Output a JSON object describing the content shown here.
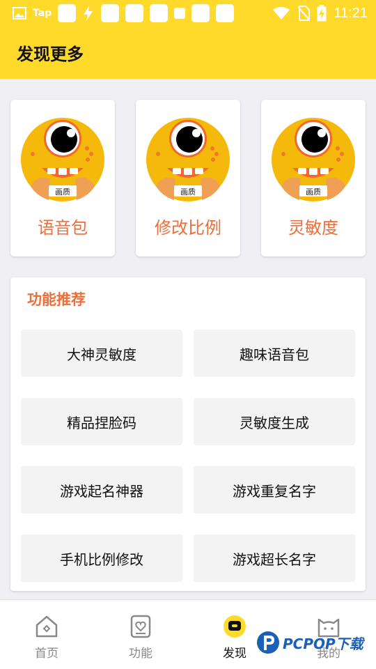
{
  "status_bar": {
    "app_label": "Tap",
    "time": "11:21"
  },
  "header": {
    "title": "发现更多"
  },
  "top_cards": [
    {
      "label": "语音包",
      "icon": "mascot-avatar"
    },
    {
      "label": "修改比例",
      "icon": "mascot-avatar"
    },
    {
      "label": "灵敏度",
      "icon": "mascot-avatar"
    }
  ],
  "mascot_badge_text": "画质",
  "features": {
    "title": "功能推荐",
    "buttons": [
      "大神灵敏度",
      "趣味语音包",
      "精品捏脸码",
      "灵敏度生成",
      "游戏起名神器",
      "游戏重复名字",
      "手机比例修改",
      "游戏超长名字"
    ]
  },
  "tabbar": {
    "tabs": [
      {
        "label": "首页",
        "icon": "home-icon",
        "active": false
      },
      {
        "label": "功能",
        "icon": "heart-card-icon",
        "active": false
      },
      {
        "label": "发现",
        "icon": "discover-icon",
        "active": true
      },
      {
        "label": "我的",
        "icon": "cat-face-icon",
        "active": false
      }
    ]
  },
  "watermark": {
    "text": "PCPOP下载"
  },
  "colors": {
    "brand_yellow": "#ffda2b",
    "accent_orange": "#ee6e3a",
    "background": "#efeff4"
  }
}
